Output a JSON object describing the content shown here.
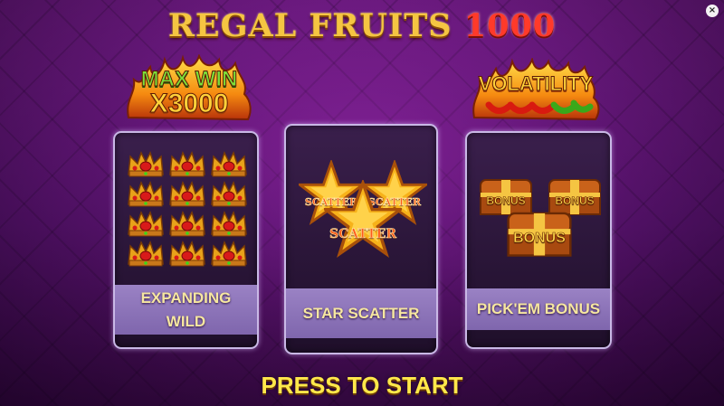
{
  "title": {
    "main": "REGAL FRUITS",
    "number": "1000"
  },
  "close_button": {
    "icon": "close-icon",
    "glyph": "×"
  },
  "badges": {
    "max_win": {
      "line1": "MAX WIN",
      "line2": "X3000"
    },
    "volatility": {
      "label": "VOLATILITY",
      "chili_count": 5
    }
  },
  "features": [
    {
      "name": "EXPANDING WILD",
      "line1": "EXPANDING",
      "line2": "WILD",
      "icon": "crown-icon"
    },
    {
      "name": "STAR SCATTER",
      "label": "STAR SCATTER",
      "symbol_text": "SCATTER",
      "icon": "star-icon"
    },
    {
      "name": "PICK'EM BONUS",
      "label": "PICK'EM BONUS",
      "symbol_text": "BONUS",
      "icon": "chest-icon"
    }
  ],
  "start_prompt": "PRESS TO START",
  "colors": {
    "title_gold": "#f5c542",
    "title_red": "#ff3a2a",
    "card_band": "#8a72b8",
    "prompt_yellow": "#ffe84a",
    "background_purple": "#6a1a80"
  }
}
